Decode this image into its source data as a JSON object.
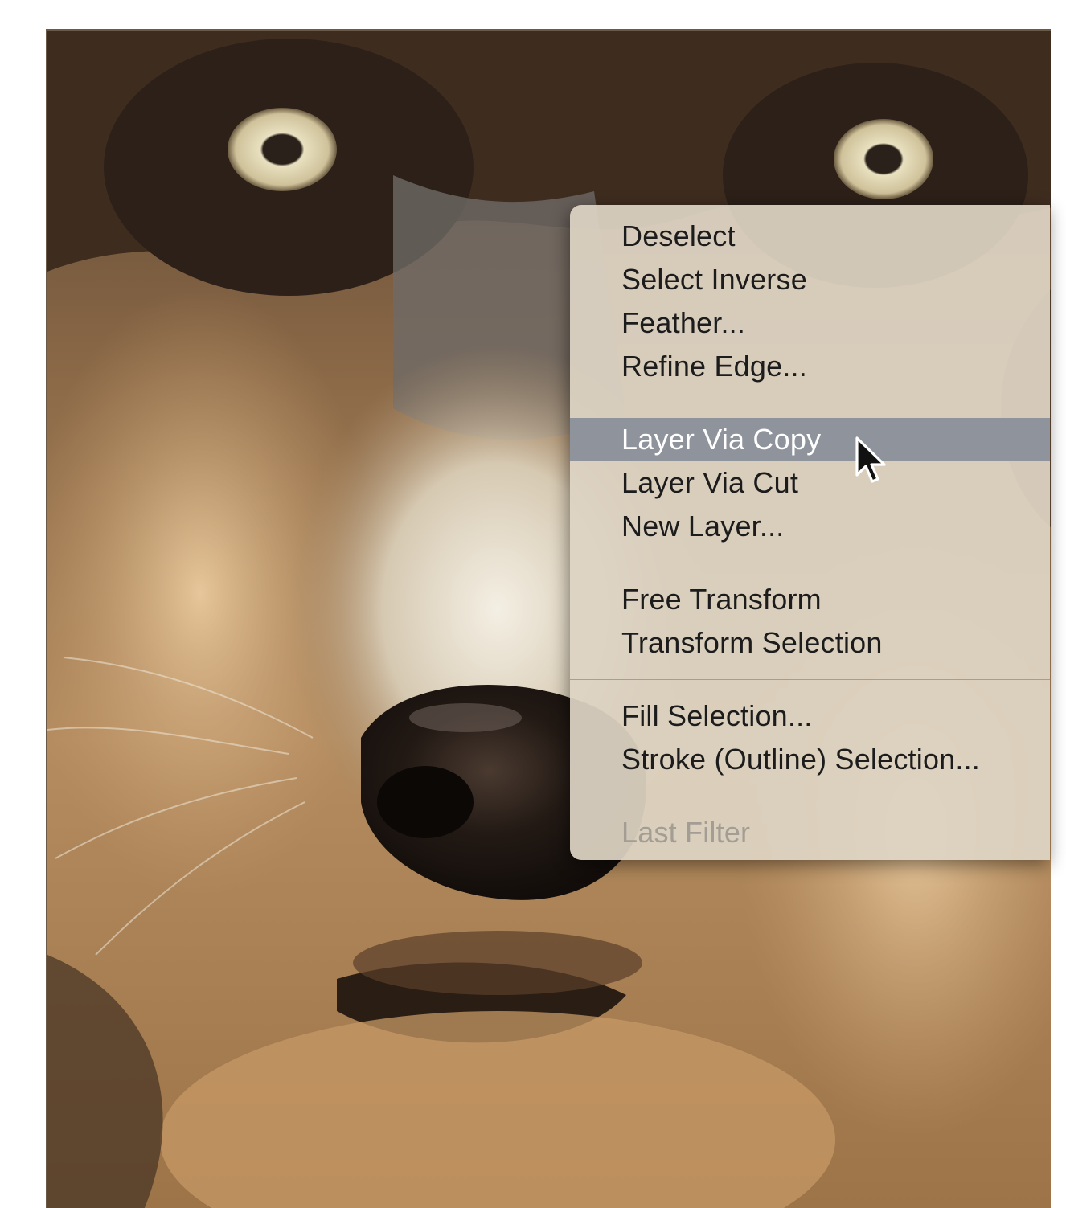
{
  "context_menu": {
    "groups": [
      {
        "items": [
          {
            "label": "Deselect",
            "state": "normal"
          },
          {
            "label": "Select Inverse",
            "state": "normal"
          },
          {
            "label": "Feather...",
            "state": "normal"
          },
          {
            "label": "Refine Edge...",
            "state": "normal"
          }
        ]
      },
      {
        "items": [
          {
            "label": "Layer Via Copy",
            "state": "highlighted"
          },
          {
            "label": "Layer Via Cut",
            "state": "normal"
          },
          {
            "label": "New Layer...",
            "state": "normal"
          }
        ]
      },
      {
        "items": [
          {
            "label": "Free Transform",
            "state": "normal"
          },
          {
            "label": "Transform Selection",
            "state": "normal"
          }
        ]
      },
      {
        "items": [
          {
            "label": "Fill Selection...",
            "state": "normal"
          },
          {
            "label": "Stroke (Outline) Selection...",
            "state": "normal"
          }
        ]
      },
      {
        "items": [
          {
            "label": "Last Filter",
            "state": "disabled"
          }
        ]
      }
    ]
  },
  "photo": {
    "subject": "wolf face close-up",
    "colors": {
      "fur_dark": "#3a2a1e",
      "fur_mid": "#9a7650",
      "fur_light": "#d9b68a",
      "muzzle_white": "#ece6d8",
      "nose": "#1e1612",
      "eye": "#e3dcbf"
    }
  },
  "cursor": {
    "icon": "arrow-pointer-icon"
  },
  "colors": {
    "menu_background": "#ded4c4",
    "highlight": "#8f949c",
    "text": "#1c1c1c",
    "disabled_text": "#a39d94"
  }
}
